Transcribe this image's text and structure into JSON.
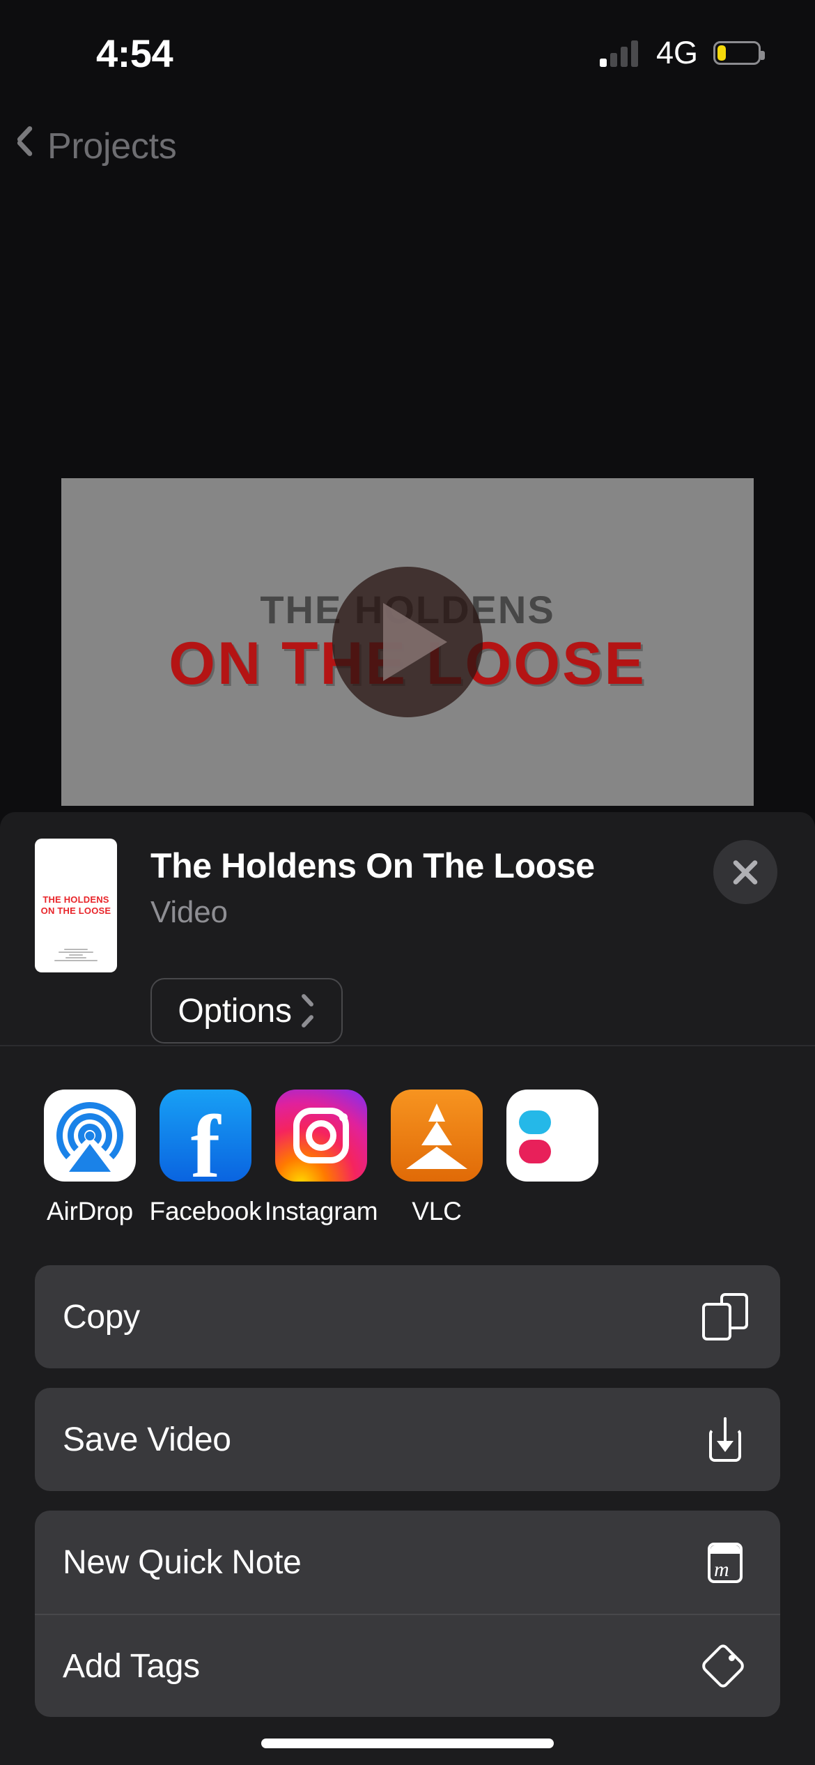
{
  "status_bar": {
    "time": "4:54",
    "carrier": "4G",
    "signal_strength": 1,
    "signal_total": 4,
    "battery_percent": 22,
    "battery_color": "#f5d90a",
    "battery_low": true
  },
  "nav": {
    "back_label": "Projects",
    "back_icon": "chevron-left-icon"
  },
  "video_preview": {
    "poster_line1": "THE HOLDENS",
    "poster_line2": "ON THE LOOSE",
    "play_icon": "play-icon",
    "background_color": "#868686",
    "title_color": "#b41414"
  },
  "share_sheet": {
    "item_title": "The Holdens On The Loose",
    "item_subtype": "Video",
    "options_label": "Options",
    "options_chevron_icon": "chevron-right-icon",
    "close_icon": "close-icon",
    "thumbnail": {
      "title": "THE HOLDENS ON THE LOOSE",
      "title_color": "#e8252a",
      "background_color": "#ffffff"
    },
    "apps": [
      {
        "label": "AirDrop",
        "icon": "airdrop-icon"
      },
      {
        "label": "Facebook",
        "icon": "facebook-icon"
      },
      {
        "label": "Instagram",
        "icon": "instagram-icon"
      },
      {
        "label": "VLC",
        "icon": "vlc-icon"
      },
      {
        "label": "",
        "icon": "partial-app-icon"
      }
    ],
    "actions": [
      {
        "label": "Copy",
        "icon": "copy-icon"
      },
      {
        "label": "Save Video",
        "icon": "save-download-icon"
      },
      {
        "label": "New Quick Note",
        "icon": "quick-note-icon"
      },
      {
        "label": "Add Tags",
        "icon": "tag-icon"
      }
    ]
  },
  "home_indicator": {
    "name": "home-indicator"
  }
}
